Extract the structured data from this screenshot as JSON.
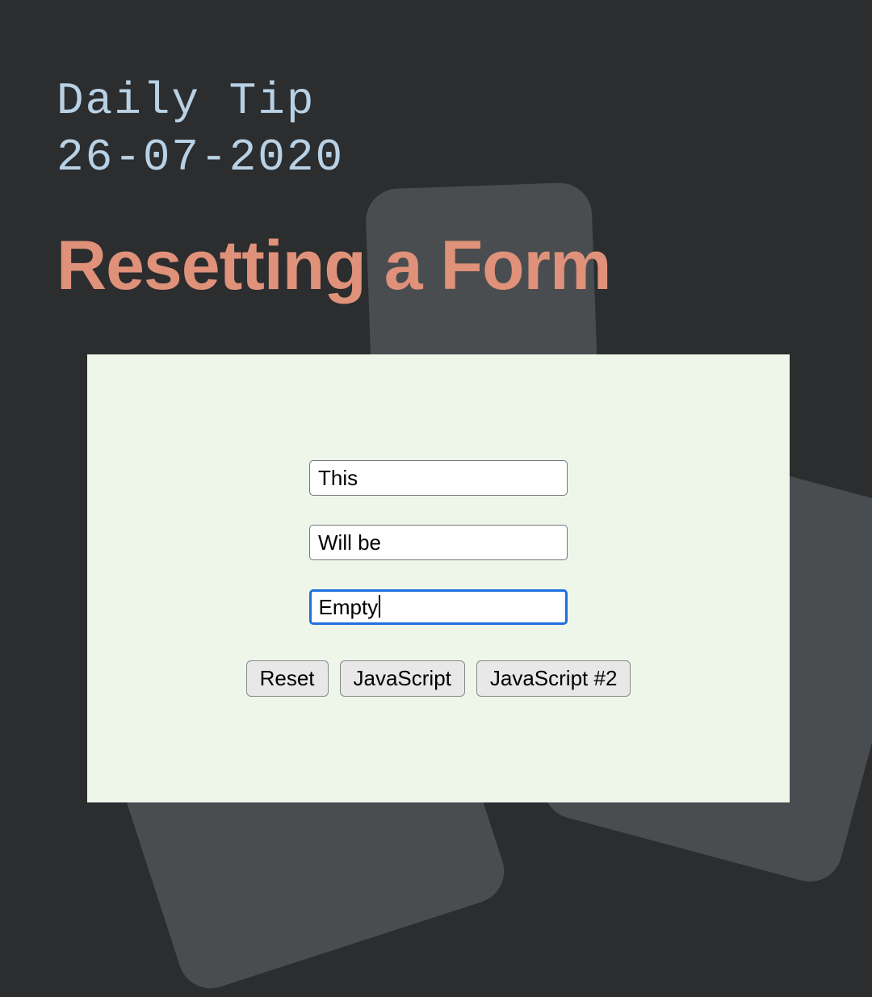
{
  "header": {
    "label": "Daily Tip",
    "date": "26-07-2020"
  },
  "title": "Resetting a Form",
  "form": {
    "inputs": [
      {
        "value": "This",
        "focused": false
      },
      {
        "value": "Will be",
        "focused": false
      },
      {
        "value": "Empty",
        "focused": true
      }
    ],
    "buttons": [
      {
        "label": "Reset"
      },
      {
        "label": "JavaScript"
      },
      {
        "label": "JavaScript #2"
      }
    ]
  }
}
